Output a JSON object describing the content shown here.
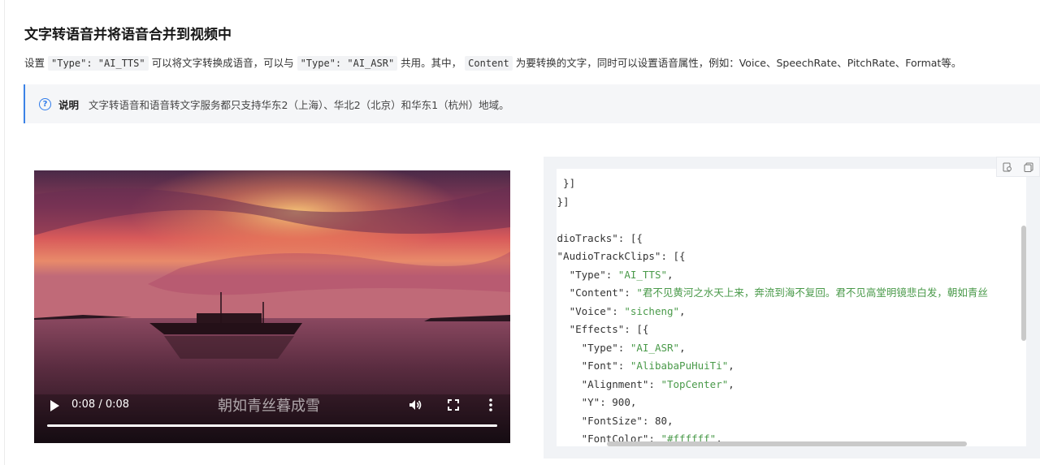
{
  "page": {
    "title": "文字转语音并将语音合并到视频中",
    "intro": {
      "p1": "设置",
      "code1": "\"Type\": \"AI_TTS\"",
      "p2": "可以将文字转换成语音，可以与",
      "code2": "\"Type\": \"AI_ASR\"",
      "p3": "共用。其中，",
      "code3": "Content",
      "p4": "为要转换的文字，同时可以设置语音属性，例如：Voice、SpeechRate、PitchRate、Format等。"
    },
    "note": {
      "label": "说明",
      "text": "文字转语音和语音转文字服务都只支持华东2（上海）、华北2（北京）和华东1（杭州）地域。",
      "icon": "question-circle-icon"
    }
  },
  "video": {
    "time": "0:08 / 0:08",
    "subtitle": "朝如青丝暮成雪",
    "progress": 1.0
  },
  "code": {
    "lines": [
      [
        [
          "k",
          "  }]"
        ]
      ],
      [
        [
          "k",
          " }]"
        ]
      ],
      [
        [
          "k",
          ","
        ]
      ],
      [
        [
          "k",
          "udioTracks\": [{"
        ]
      ],
      [
        [
          "k",
          " \"AudioTrackClips\": [{"
        ]
      ],
      [
        [
          "k",
          "   \"Type\": "
        ],
        [
          "s",
          "\"AI_TTS\""
        ],
        [
          "k",
          ","
        ]
      ],
      [
        [
          "k",
          "   \"Content\": "
        ],
        [
          "s",
          "\"君不见黄河之水天上来，奔流到海不复回。君不见高堂明镜悲白发，朝如青丝"
        ]
      ],
      [
        [
          "k",
          "   \"Voice\": "
        ],
        [
          "s",
          "\"sicheng\""
        ],
        [
          "k",
          ","
        ]
      ],
      [
        [
          "k",
          "   \"Effects\": [{"
        ]
      ],
      [
        [
          "k",
          "     \"Type\": "
        ],
        [
          "s",
          "\"AI_ASR\""
        ],
        [
          "k",
          ","
        ]
      ],
      [
        [
          "k",
          "     \"Font\": "
        ],
        [
          "s",
          "\"AlibabaPuHuiTi\""
        ],
        [
          "k",
          ","
        ]
      ],
      [
        [
          "k",
          "     \"Alignment\": "
        ],
        [
          "s",
          "\"TopCenter\""
        ],
        [
          "k",
          ","
        ]
      ],
      [
        [
          "k",
          "     \"Y\": "
        ],
        [
          "n",
          "900"
        ],
        [
          "k",
          ","
        ]
      ],
      [
        [
          "k",
          "     \"FontSize\": "
        ],
        [
          "n",
          "80"
        ],
        [
          "k",
          ","
        ]
      ],
      [
        [
          "k",
          "     \"FontColor\": "
        ],
        [
          "s",
          "\"#ffffff\""
        ],
        [
          "k",
          ","
        ]
      ]
    ]
  },
  "toolbar": {
    "icons": [
      "copy-code-icon",
      "copy-icon"
    ]
  },
  "colors": {
    "accent": "#3b82e6",
    "string": "#4a9a4a"
  }
}
